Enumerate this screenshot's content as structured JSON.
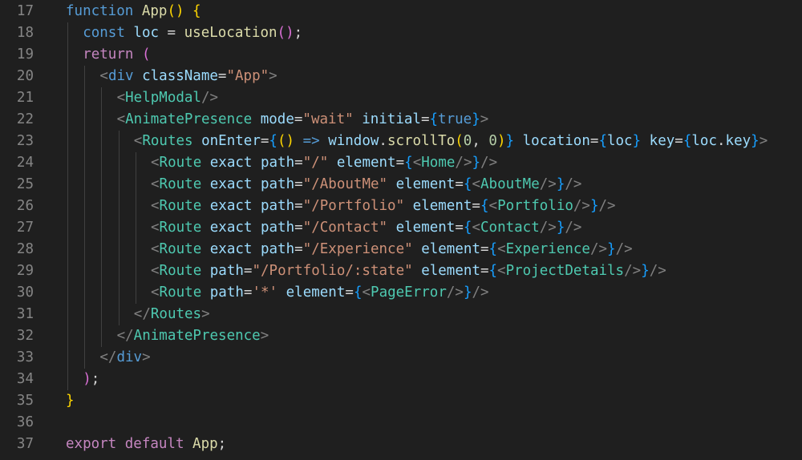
{
  "editor": {
    "language": "javascript-jsx",
    "lines": [
      {
        "number": "17",
        "indent": 0,
        "tokens": [
          [
            "kw",
            "function "
          ],
          [
            "fn",
            "App"
          ],
          [
            "b1",
            "() {"
          ]
        ]
      },
      {
        "number": "18",
        "indent": 1,
        "tokens": [
          [
            "kw",
            "const "
          ],
          [
            "var",
            "loc"
          ],
          [
            "pn",
            " = "
          ],
          [
            "fn",
            "useLocation"
          ],
          [
            "b2",
            "()"
          ],
          [
            "pn",
            ";"
          ]
        ]
      },
      {
        "number": "19",
        "indent": 1,
        "tokens": [
          [
            "ctl",
            "return "
          ],
          [
            "b2",
            "("
          ]
        ]
      },
      {
        "number": "20",
        "indent": 2,
        "tokens": [
          [
            "ang",
            "<"
          ],
          [
            "kw",
            "div "
          ],
          [
            "var",
            "className"
          ],
          [
            "pn",
            "="
          ],
          [
            "str",
            "\"App\""
          ],
          [
            "ang",
            ">"
          ]
        ]
      },
      {
        "number": "21",
        "indent": 3,
        "tokens": [
          [
            "ang",
            "<"
          ],
          [
            "tag",
            "HelpModal"
          ],
          [
            "ang",
            "/>"
          ]
        ]
      },
      {
        "number": "22",
        "indent": 3,
        "tokens": [
          [
            "ang",
            "<"
          ],
          [
            "tag",
            "AnimatePresence "
          ],
          [
            "var",
            "mode"
          ],
          [
            "pn",
            "="
          ],
          [
            "str",
            "\"wait\" "
          ],
          [
            "var",
            "initial"
          ],
          [
            "pn",
            "="
          ],
          [
            "b3",
            "{"
          ],
          [
            "kw",
            "true"
          ],
          [
            "b3",
            "}"
          ],
          [
            "ang",
            ">"
          ]
        ]
      },
      {
        "number": "23",
        "indent": 4,
        "tokens": [
          [
            "ang",
            "<"
          ],
          [
            "tag",
            "Routes "
          ],
          [
            "var",
            "onEnter"
          ],
          [
            "pn",
            "="
          ],
          [
            "b3",
            "{"
          ],
          [
            "b1",
            "() "
          ],
          [
            "kw",
            "=> "
          ],
          [
            "var",
            "window"
          ],
          [
            "pn",
            "."
          ],
          [
            "fn",
            "scrollTo"
          ],
          [
            "b1",
            "("
          ],
          [
            "num",
            "0"
          ],
          [
            "pn",
            ", "
          ],
          [
            "num",
            "0"
          ],
          [
            "b1",
            ")"
          ],
          [
            "b3",
            "} "
          ],
          [
            "var",
            "location"
          ],
          [
            "pn",
            "="
          ],
          [
            "b3",
            "{"
          ],
          [
            "var",
            "loc"
          ],
          [
            "b3",
            "} "
          ],
          [
            "var",
            "key"
          ],
          [
            "pn",
            "="
          ],
          [
            "b3",
            "{"
          ],
          [
            "var",
            "loc"
          ],
          [
            "pn",
            "."
          ],
          [
            "var",
            "key"
          ],
          [
            "b3",
            "}"
          ],
          [
            "ang",
            ">"
          ]
        ]
      },
      {
        "number": "24",
        "indent": 5,
        "tokens": [
          [
            "ang",
            "<"
          ],
          [
            "tag",
            "Route "
          ],
          [
            "var",
            "exact "
          ],
          [
            "var",
            "path"
          ],
          [
            "pn",
            "="
          ],
          [
            "str",
            "\"/\" "
          ],
          [
            "var",
            "element"
          ],
          [
            "pn",
            "="
          ],
          [
            "b3",
            "{"
          ],
          [
            "ang",
            "<"
          ],
          [
            "tag",
            "Home"
          ],
          [
            "ang",
            "/>"
          ],
          [
            "b3",
            "}"
          ],
          [
            "ang",
            "/>"
          ]
        ]
      },
      {
        "number": "25",
        "indent": 5,
        "tokens": [
          [
            "ang",
            "<"
          ],
          [
            "tag",
            "Route "
          ],
          [
            "var",
            "exact "
          ],
          [
            "var",
            "path"
          ],
          [
            "pn",
            "="
          ],
          [
            "str",
            "\"/AboutMe\" "
          ],
          [
            "var",
            "element"
          ],
          [
            "pn",
            "="
          ],
          [
            "b3",
            "{"
          ],
          [
            "ang",
            "<"
          ],
          [
            "tag",
            "AboutMe"
          ],
          [
            "ang",
            "/>"
          ],
          [
            "b3",
            "}"
          ],
          [
            "ang",
            "/>"
          ]
        ]
      },
      {
        "number": "26",
        "indent": 5,
        "tokens": [
          [
            "ang",
            "<"
          ],
          [
            "tag",
            "Route "
          ],
          [
            "var",
            "exact "
          ],
          [
            "var",
            "path"
          ],
          [
            "pn",
            "="
          ],
          [
            "str",
            "\"/Portfolio\" "
          ],
          [
            "var",
            "element"
          ],
          [
            "pn",
            "="
          ],
          [
            "b3",
            "{"
          ],
          [
            "ang",
            "<"
          ],
          [
            "tag",
            "Portfolio"
          ],
          [
            "ang",
            "/>"
          ],
          [
            "b3",
            "}"
          ],
          [
            "ang",
            "/>"
          ]
        ]
      },
      {
        "number": "27",
        "indent": 5,
        "tokens": [
          [
            "ang",
            "<"
          ],
          [
            "tag",
            "Route "
          ],
          [
            "var",
            "exact "
          ],
          [
            "var",
            "path"
          ],
          [
            "pn",
            "="
          ],
          [
            "str",
            "\"/Contact\" "
          ],
          [
            "var",
            "element"
          ],
          [
            "pn",
            "="
          ],
          [
            "b3",
            "{"
          ],
          [
            "ang",
            "<"
          ],
          [
            "tag",
            "Contact"
          ],
          [
            "ang",
            "/>"
          ],
          [
            "b3",
            "}"
          ],
          [
            "ang",
            "/>"
          ]
        ]
      },
      {
        "number": "28",
        "indent": 5,
        "tokens": [
          [
            "ang",
            "<"
          ],
          [
            "tag",
            "Route "
          ],
          [
            "var",
            "exact "
          ],
          [
            "var",
            "path"
          ],
          [
            "pn",
            "="
          ],
          [
            "str",
            "\"/Experience\" "
          ],
          [
            "var",
            "element"
          ],
          [
            "pn",
            "="
          ],
          [
            "b3",
            "{"
          ],
          [
            "ang",
            "<"
          ],
          [
            "tag",
            "Experience"
          ],
          [
            "ang",
            "/>"
          ],
          [
            "b3",
            "}"
          ],
          [
            "ang",
            "/>"
          ]
        ]
      },
      {
        "number": "29",
        "indent": 5,
        "tokens": [
          [
            "ang",
            "<"
          ],
          [
            "tag",
            "Route "
          ],
          [
            "var",
            "path"
          ],
          [
            "pn",
            "="
          ],
          [
            "str",
            "\"/Portfolio/:state\" "
          ],
          [
            "var",
            "element"
          ],
          [
            "pn",
            "="
          ],
          [
            "b3",
            "{"
          ],
          [
            "ang",
            "<"
          ],
          [
            "tag",
            "ProjectDetails"
          ],
          [
            "ang",
            "/>"
          ],
          [
            "b3",
            "}"
          ],
          [
            "ang",
            "/>"
          ]
        ]
      },
      {
        "number": "30",
        "indent": 5,
        "tokens": [
          [
            "ang",
            "<"
          ],
          [
            "tag",
            "Route "
          ],
          [
            "var",
            "path"
          ],
          [
            "pn",
            "="
          ],
          [
            "str",
            "'*' "
          ],
          [
            "var",
            "element"
          ],
          [
            "pn",
            "="
          ],
          [
            "b3",
            "{"
          ],
          [
            "ang",
            "<"
          ],
          [
            "tag",
            "PageError"
          ],
          [
            "ang",
            "/>"
          ],
          [
            "b3",
            "}"
          ],
          [
            "ang",
            "/>"
          ]
        ]
      },
      {
        "number": "31",
        "indent": 4,
        "tokens": [
          [
            "ang",
            "</"
          ],
          [
            "tag",
            "Routes"
          ],
          [
            "ang",
            ">"
          ]
        ]
      },
      {
        "number": "32",
        "indent": 3,
        "tokens": [
          [
            "ang",
            "</"
          ],
          [
            "tag",
            "AnimatePresence"
          ],
          [
            "ang",
            ">"
          ]
        ]
      },
      {
        "number": "33",
        "indent": 2,
        "tokens": [
          [
            "ang",
            "</"
          ],
          [
            "kw",
            "div"
          ],
          [
            "ang",
            ">"
          ]
        ]
      },
      {
        "number": "34",
        "indent": 1,
        "tokens": [
          [
            "b2",
            ")"
          ],
          [
            "pn",
            ";"
          ]
        ]
      },
      {
        "number": "35",
        "indent": 0,
        "tokens": [
          [
            "b1",
            "}"
          ]
        ]
      },
      {
        "number": "36",
        "indent": 0,
        "tokens": []
      },
      {
        "number": "37",
        "indent": 0,
        "tokens": [
          [
            "ctl",
            "export default "
          ],
          [
            "fn",
            "App"
          ],
          [
            "pn",
            ";"
          ]
        ]
      }
    ]
  }
}
